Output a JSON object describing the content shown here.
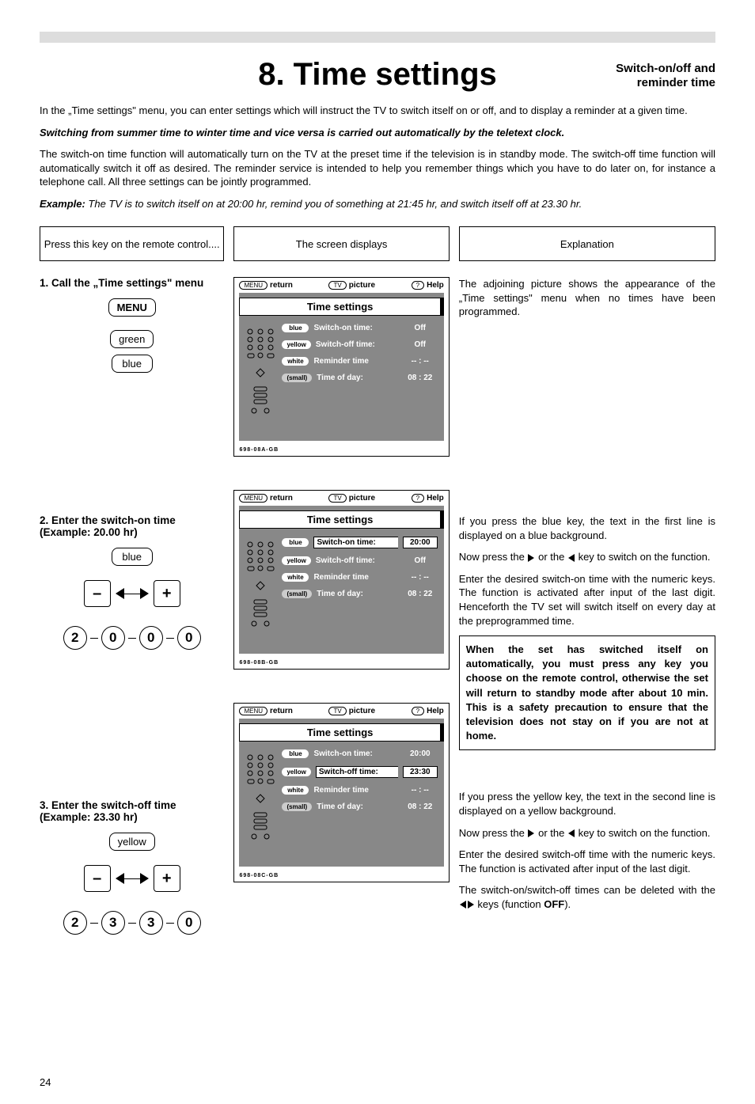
{
  "header": {
    "title": "8. Time settings",
    "subtitle_line1": "Switch-on/off and",
    "subtitle_line2": "reminder time"
  },
  "intro": {
    "p1": "In the „Time settings\" menu, you can enter settings which will instruct the TV to switch itself on or off, and to display a reminder at a given time.",
    "p2": "Switching from summer time to winter time and vice versa is carried out automatically by the teletext clock.",
    "p3": "The switch-on time function will automatically turn on the TV at the preset time if the television is in standby mode. The switch-off time function will automatically switch it off as desired. The reminder service is intended to help you remember things which you have to do later on, for instance a telephone call. All three settings can be jointly programmed.",
    "example_label": "Example:",
    "example_text": " The TV is to switch itself on at 20:00 hr, remind you of something at 21:45 hr, and switch itself off at 23.30 hr."
  },
  "col_headers": {
    "left": "Press this key on the remote control....",
    "mid": "The screen displays",
    "right": "Explanation"
  },
  "steps": {
    "s1": {
      "title": "1. Call the „Time settings\" menu",
      "keys": {
        "menu": "MENU",
        "green": "green",
        "blue": "blue"
      }
    },
    "s2": {
      "title": "2. Enter the switch-on time (Example: 20.00 hr)",
      "key": "blue",
      "digits": [
        "2",
        "0",
        "0",
        "0"
      ]
    },
    "s3": {
      "title": "3. Enter the switch-off time (Example: 23.30 hr)",
      "key": "yellow",
      "digits": [
        "2",
        "3",
        "3",
        "0"
      ]
    }
  },
  "osd_common": {
    "return": "return",
    "menu_pill": "MENU",
    "picture": "picture",
    "tv_pill": "TV",
    "help": "Help",
    "q_pill": "?",
    "title": "Time settings",
    "row_on": "Switch-on time:",
    "row_off": "Switch-off time:",
    "row_rem": "Reminder time",
    "row_tod": "Time of day:",
    "pill_blue": "blue",
    "pill_yellow": "yellow",
    "pill_white": "white",
    "pill_small": "(small)"
  },
  "osd1": {
    "on": "Off",
    "off": "Off",
    "rem": "-- : --",
    "tod": "08 : 22",
    "footer": "698-08A-GB"
  },
  "osd2": {
    "on": "20:00",
    "off": "Off",
    "rem": "-- : --",
    "tod": "08 : 22",
    "footer": "698-08B-GB"
  },
  "osd3": {
    "on": "20:00",
    "off": "23:30",
    "rem": "-- : --",
    "tod": "08 : 22",
    "footer": "698-08C-GB"
  },
  "exp": {
    "e1": "The adjoining picture shows the appearance of the „Time settings\" menu when no times have been programmed.",
    "e2a": "If you press the blue key, the text in the first line is displayed on a blue background.",
    "e2b_pre": "Now press the ",
    "e2b_mid": " or the ",
    "e2b_post": " key to switch on the function.",
    "e2c": "Enter the desired switch-on time with the numeric keys. The function is activated after input of the last digit. Henceforth the TV set will switch itself on every day at the preprogrammed time.",
    "e2box": "When the set has switched itself on automatically, you must press any key you choose on the remote control, otherwise the set will return to standby mode after about 10 min. This is a safety precaution to ensure that the television does not stay on if you are not at home.",
    "e3a": "If you press the yellow key, the text in the second line is displayed on a yellow background.",
    "e3b_pre": "Now press the ",
    "e3b_mid": " or the ",
    "e3b_post": " key to switch on the function.",
    "e3c": "Enter the desired switch-off time with the numeric keys. The function is activated after input of the last digit.",
    "e3d_pre": "The switch-on/switch-off times can be deleted with the ",
    "e3d_post": " keys (function ",
    "e3d_off": "OFF",
    "e3d_end": ")."
  },
  "page_number": "24"
}
